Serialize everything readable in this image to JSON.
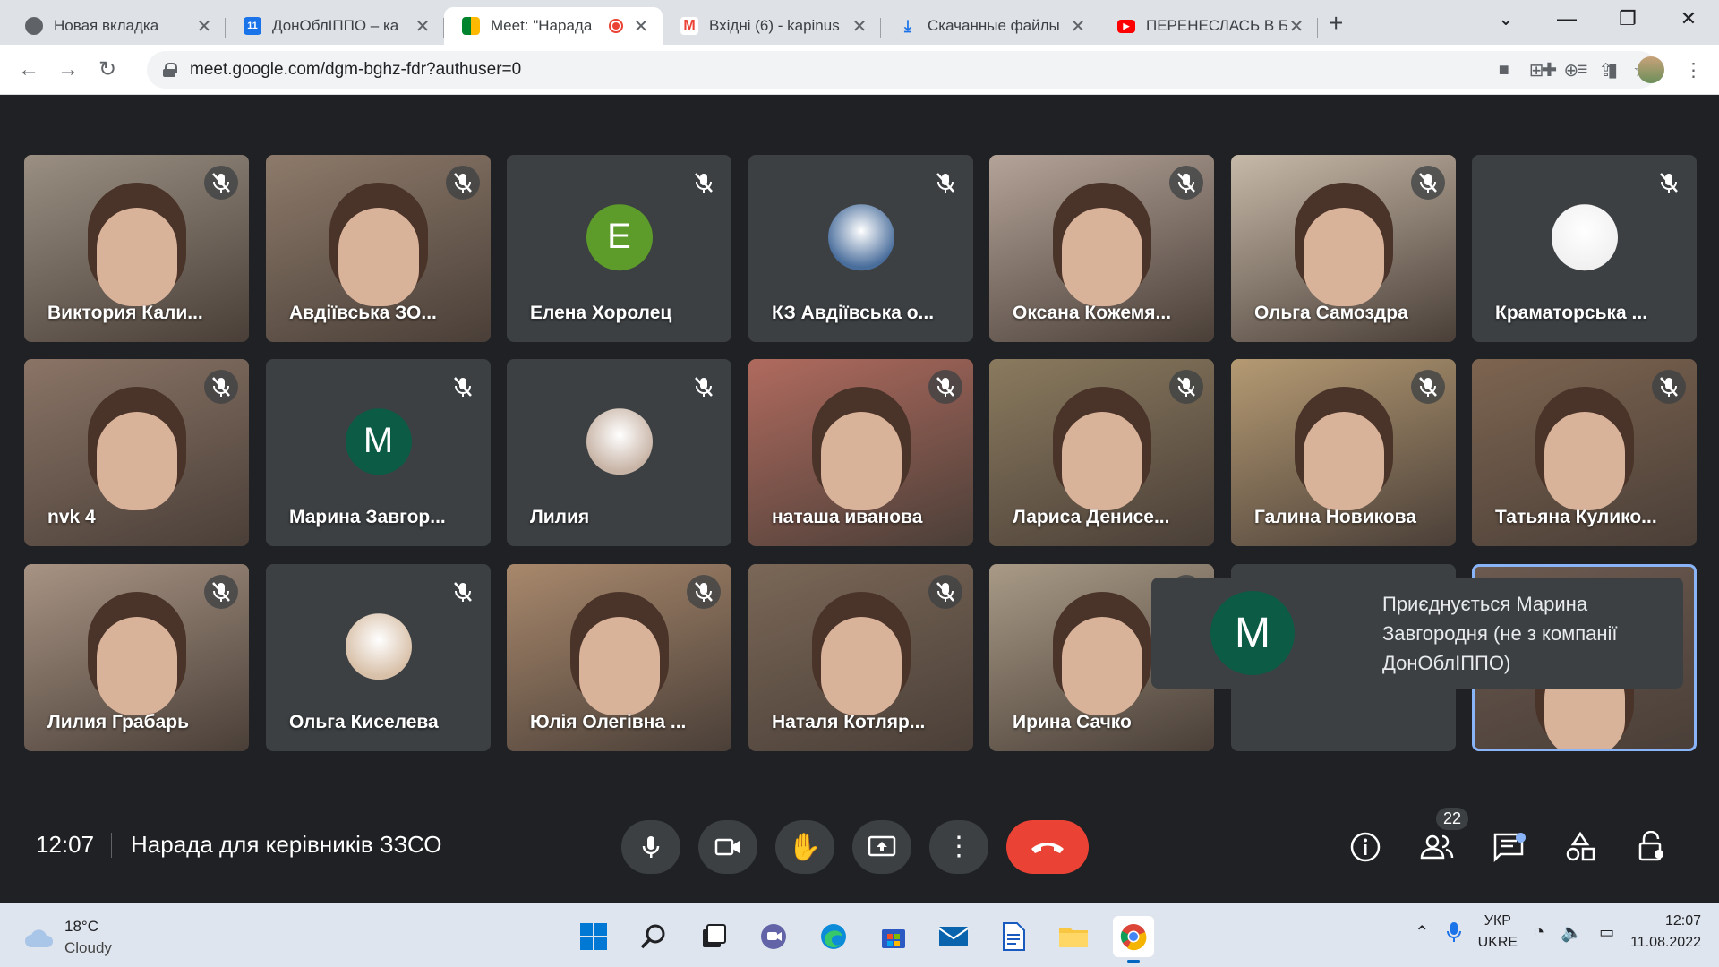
{
  "browser": {
    "tabs": [
      {
        "title": "Новая вкладка",
        "favicon": "chrome-icon",
        "active": false
      },
      {
        "title": "ДонОблІППО – ка",
        "favicon": "calendar-icon",
        "active": false
      },
      {
        "title": "Meet: \"Нарада",
        "favicon": "meet-icon",
        "active": true
      },
      {
        "title": "Вхідні (6) - kapinus",
        "favicon": "gmail-icon",
        "active": false
      },
      {
        "title": "Скачанные файлы",
        "favicon": "download-icon",
        "active": false
      },
      {
        "title": "ПЕРЕНЕСЛАСЬ В Б",
        "favicon": "youtube-icon",
        "active": false
      }
    ],
    "new_tab": "+",
    "url": "meet.google.com/dgm-bghz-fdr?authuser=0",
    "calendar_fav_text": "11"
  },
  "participants": [
    {
      "name": "Виктория Кали...",
      "type": "video",
      "bg": "#9a8f82",
      "muted": true
    },
    {
      "name": "Авдіївська ЗО...",
      "type": "video",
      "bg": "#8d7a6a",
      "muted": true
    },
    {
      "name": "Елена Хоролец",
      "type": "initial",
      "initial": "Е",
      "color": "#5d9b2a",
      "muted": true
    },
    {
      "name": "КЗ Авдіївська о...",
      "type": "picture",
      "color": "#4a6e9c",
      "muted": true
    },
    {
      "name": "Оксана Кожемя...",
      "type": "video",
      "bg": "#b4a398",
      "muted": true
    },
    {
      "name": "Ольга Самоздра",
      "type": "video",
      "bg": "#c7b9a8",
      "muted": true
    },
    {
      "name": "Краматорська ...",
      "type": "picture",
      "color": "#f1f1f1",
      "muted": true
    },
    {
      "name": "nvk 4",
      "type": "video",
      "bg": "#8a7466",
      "muted": true
    },
    {
      "name": "Марина Завгор...",
      "type": "initial",
      "initial": "М",
      "color": "#0b5b45",
      "muted": true
    },
    {
      "name": "Лилия",
      "type": "picture",
      "color": "#c8b4a6",
      "muted": true
    },
    {
      "name": "наташа иванова",
      "type": "video",
      "bg": "#b06a5e",
      "muted": true
    },
    {
      "name": "Лариса Денисе...",
      "type": "video",
      "bg": "#8a7a5e",
      "muted": true
    },
    {
      "name": "Галина Новикова",
      "type": "video",
      "bg": "#b59a73",
      "muted": true
    },
    {
      "name": "Татьяна Кулико...",
      "type": "video",
      "bg": "#7d6450",
      "muted": true
    },
    {
      "name": "Лилия Грабарь",
      "type": "video",
      "bg": "#a79383",
      "muted": true
    },
    {
      "name": "Ольга Киселева",
      "type": "picture",
      "color": "#d8c0a8",
      "muted": true
    },
    {
      "name": "Юлія Олегівна ...",
      "type": "video",
      "bg": "#a8886c",
      "muted": true
    },
    {
      "name": "Наталя Котляр...",
      "type": "video",
      "bg": "#7a6757",
      "muted": true
    },
    {
      "name": "Ирина Сачко",
      "type": "video",
      "bg": "#a89a86",
      "muted": true
    },
    {
      "name": "",
      "type": "group",
      "muted": false
    },
    {
      "name": "",
      "type": "self",
      "bg": "#6c5a50",
      "muted": false
    }
  ],
  "toast": {
    "initial": "М",
    "text": "Приєднується Марина Завгородня (не з компанії ДонОблІППО)"
  },
  "meeting": {
    "time": "12:07",
    "title": "Нарада для керівників ЗЗСО",
    "participant_count": "22"
  },
  "taskbar": {
    "temperature": "18°C",
    "weather": "Cloudy",
    "lang_top": "УКР",
    "lang_bottom": "UKRE",
    "time": "12:07",
    "date": "11.08.2022"
  },
  "colors": {
    "end_call": "#ea4335",
    "accent": "#1a73e8",
    "meet_bg": "#202124"
  }
}
